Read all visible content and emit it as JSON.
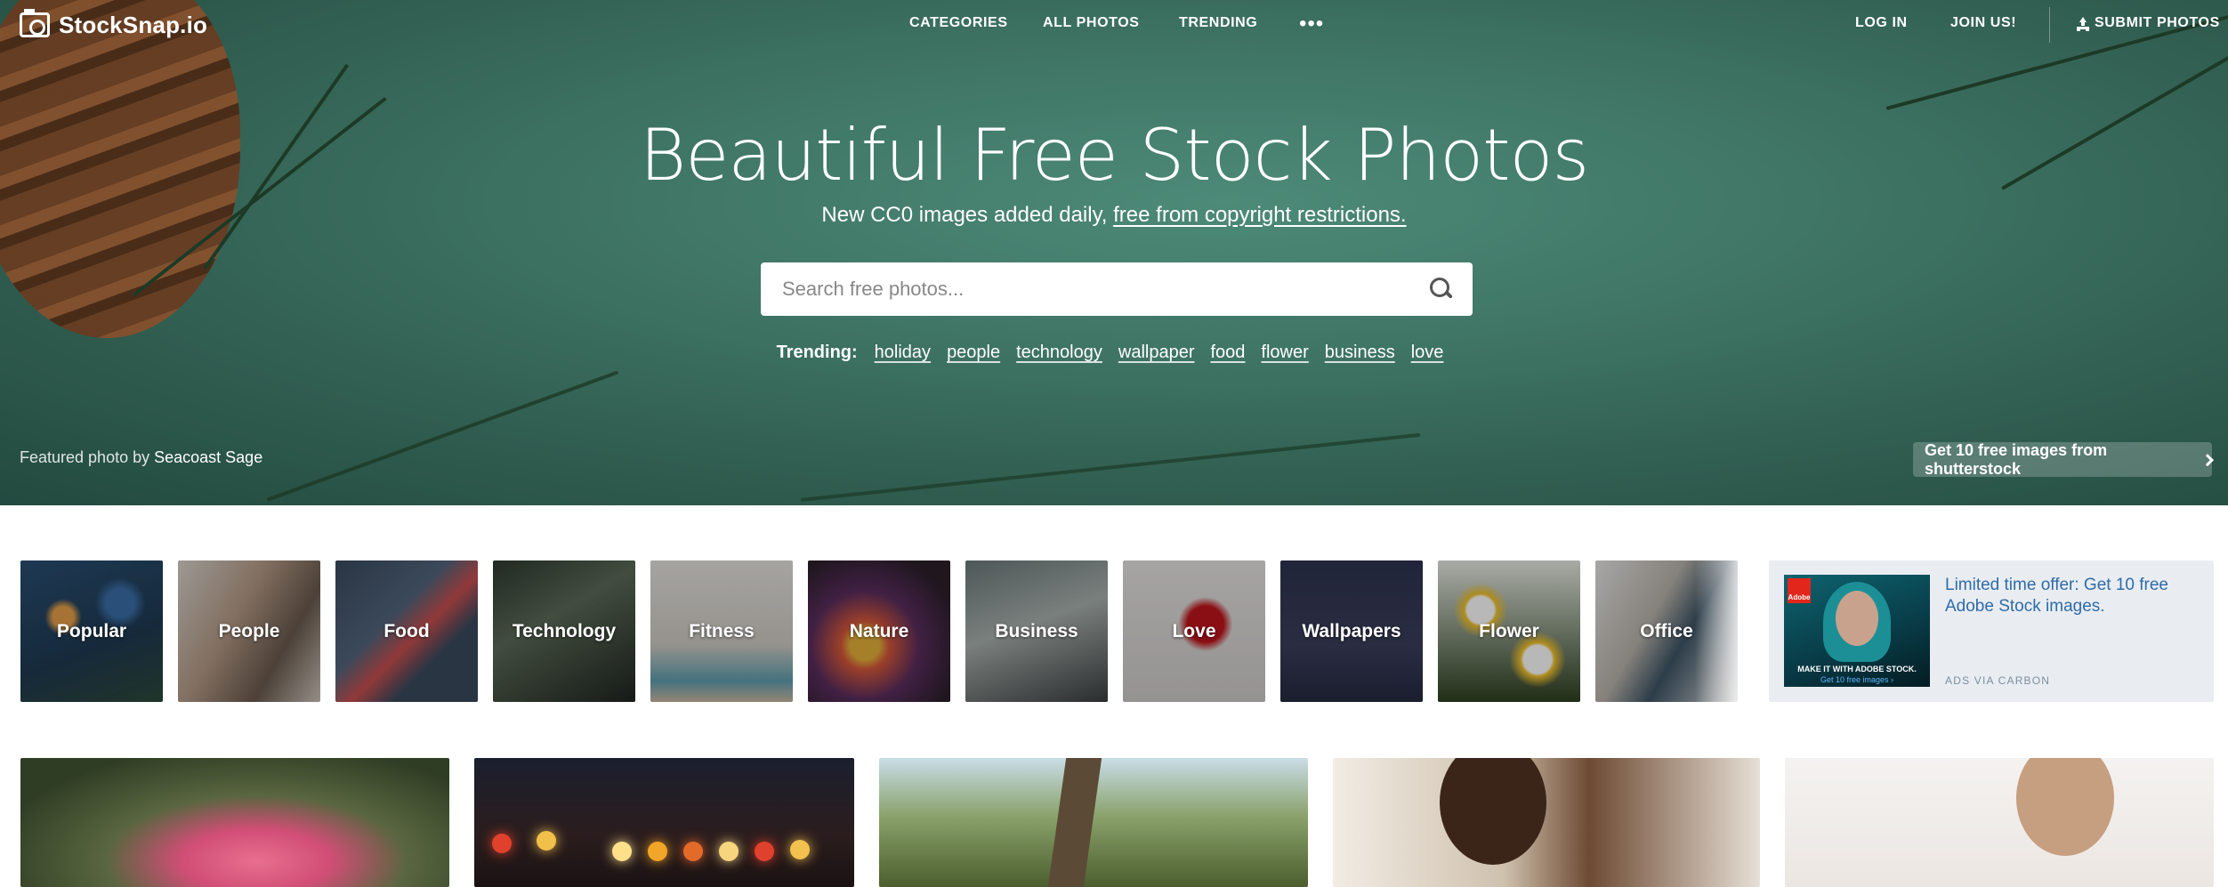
{
  "header": {
    "logo_text": "StockSnap.io",
    "nav": [
      "CATEGORIES",
      "ALL PHOTOS",
      "TRENDING"
    ],
    "more_label": "•••",
    "login_label": "LOG IN",
    "join_label": "JOIN US!",
    "submit_label": "SUBMIT PHOTOS"
  },
  "hero": {
    "title": "Beautiful Free Stock Photos",
    "subtitle_plain": "New CC0 images added daily, ",
    "subtitle_link": "free from copyright restrictions.",
    "search_placeholder": "Search free photos...",
    "trending_label": "Trending:",
    "trending_tags": [
      "holiday",
      "people",
      "technology",
      "wallpaper",
      "food",
      "flower",
      "business",
      "love"
    ],
    "featured_prefix": "Featured photo by ",
    "featured_author": "Seacoast Sage",
    "shutterstock_cta": "Get 10 free images from shutterstock"
  },
  "categories": [
    "Popular",
    "People",
    "Food",
    "Technology",
    "Fitness",
    "Nature",
    "Business",
    "Love",
    "Wallpapers",
    "Flower",
    "Office"
  ],
  "ad": {
    "text": "Limited time offer: Get 10 free Adobe Stock images.",
    "via": "ADS VIA CARBON",
    "image_tagline": "MAKE IT WITH ADOBE STOCK.",
    "image_cta": "Get 10 free images ›",
    "logo_text": "Adobe"
  }
}
